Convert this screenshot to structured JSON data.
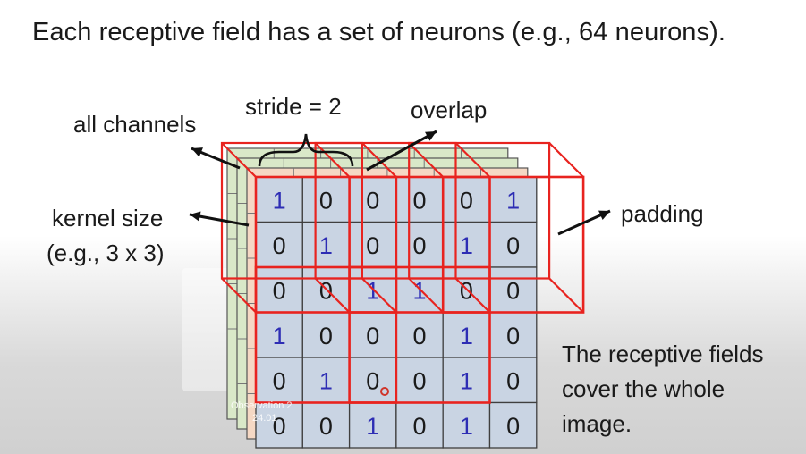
{
  "headline": "Each receptive field has a set of neurons (e.g., 64 neurons).",
  "labels": {
    "stride": "stride = 2",
    "overlap": "overlap",
    "all_channels": "all channels",
    "kernel_size_line1": "kernel size",
    "kernel_size_line2": "(e.g., 3 x 3)",
    "padding": "padding"
  },
  "caption": {
    "line1": "The receptive fields",
    "line2": "cover the whole",
    "line3": "image."
  },
  "grid": [
    [
      1,
      0,
      0,
      0,
      0,
      1
    ],
    [
      0,
      1,
      0,
      0,
      1,
      0
    ],
    [
      0,
      0,
      1,
      1,
      0,
      0
    ],
    [
      1,
      0,
      0,
      0,
      1,
      0
    ],
    [
      0,
      1,
      0,
      0,
      1,
      0
    ],
    [
      0,
      0,
      1,
      0,
      1,
      0
    ]
  ],
  "colors": {
    "one_digit": "#2d2db4",
    "zero_digit": "#1a1a1a",
    "cell_fill": "#c9d4e3",
    "cell_border": "#3f3f3f",
    "field_outline": "#e8231f",
    "arrow": "#111111",
    "back_channel_green": "#d9e8c8",
    "back_channel_peach": "#f5d8c4"
  },
  "overlay": {
    "line1": "Observation 2",
    "line2": "24.01"
  }
}
